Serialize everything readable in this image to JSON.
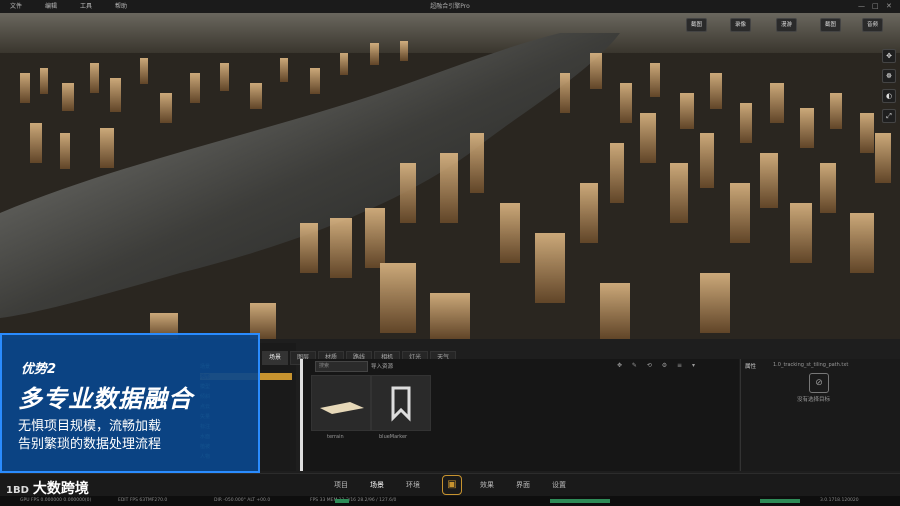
{
  "menubar": {
    "items": [
      "文件",
      "编辑",
      "工具",
      "帮助"
    ],
    "title": "超融合引擎Pro",
    "window_controls": [
      "—",
      "□",
      "✕"
    ]
  },
  "viewport": {
    "toolbar": [
      "截图",
      "录像",
      "漫游",
      "截图",
      "音频"
    ],
    "side_tools": [
      "✥",
      "☸",
      "◐",
      "⤢"
    ]
  },
  "panel": {
    "tabs": [
      "场景",
      "图层",
      "材质",
      "路线",
      "相机",
      "灯光",
      "天气"
    ],
    "tree_rows": [
      "场景",
      "地形",
      "模型",
      "倾斜",
      "点云",
      "矢量",
      "标注",
      "水面",
      "植被",
      "人物"
    ],
    "search_placeholder": "搜索",
    "asset_head": "导入资源",
    "asset_tools": "✥ ✎ ⟲ ⚙ ≡ ▾",
    "assets": [
      "terrain",
      "blueMarker"
    ]
  },
  "properties": {
    "header": "属性",
    "path": "1.0_tracking_st_tiling_path.txt",
    "no_selection": "没有选择目标"
  },
  "bottom_nav": {
    "items": [
      "项目",
      "场景",
      "环境",
      "",
      "效果",
      "界面",
      "设置"
    ],
    "active": "场景"
  },
  "statusbar": {
    "left": "GPU FPS 0.000000 0.000000(0)",
    "mid1": "EDIT FPS 63TMF270.0",
    "mid2": "DIR -050.000° ALT +00.0",
    "mid3": "FPS 33 MEM 13.3/16 28.2/96 / 127.6/0",
    "right": "3.0.1718.120020"
  },
  "promo": {
    "tag": "优势2",
    "headline": "多专业数据融合",
    "sub1": "无惧项目规模，流畅加载",
    "sub2": "告别繁琐的数据处理流程"
  },
  "brand": {
    "mark": "1BD",
    "name": "大数跨境"
  },
  "colors": {
    "accent": "#c7932f",
    "promo_bg": "#0a468c",
    "promo_border": "#2a8cff"
  }
}
